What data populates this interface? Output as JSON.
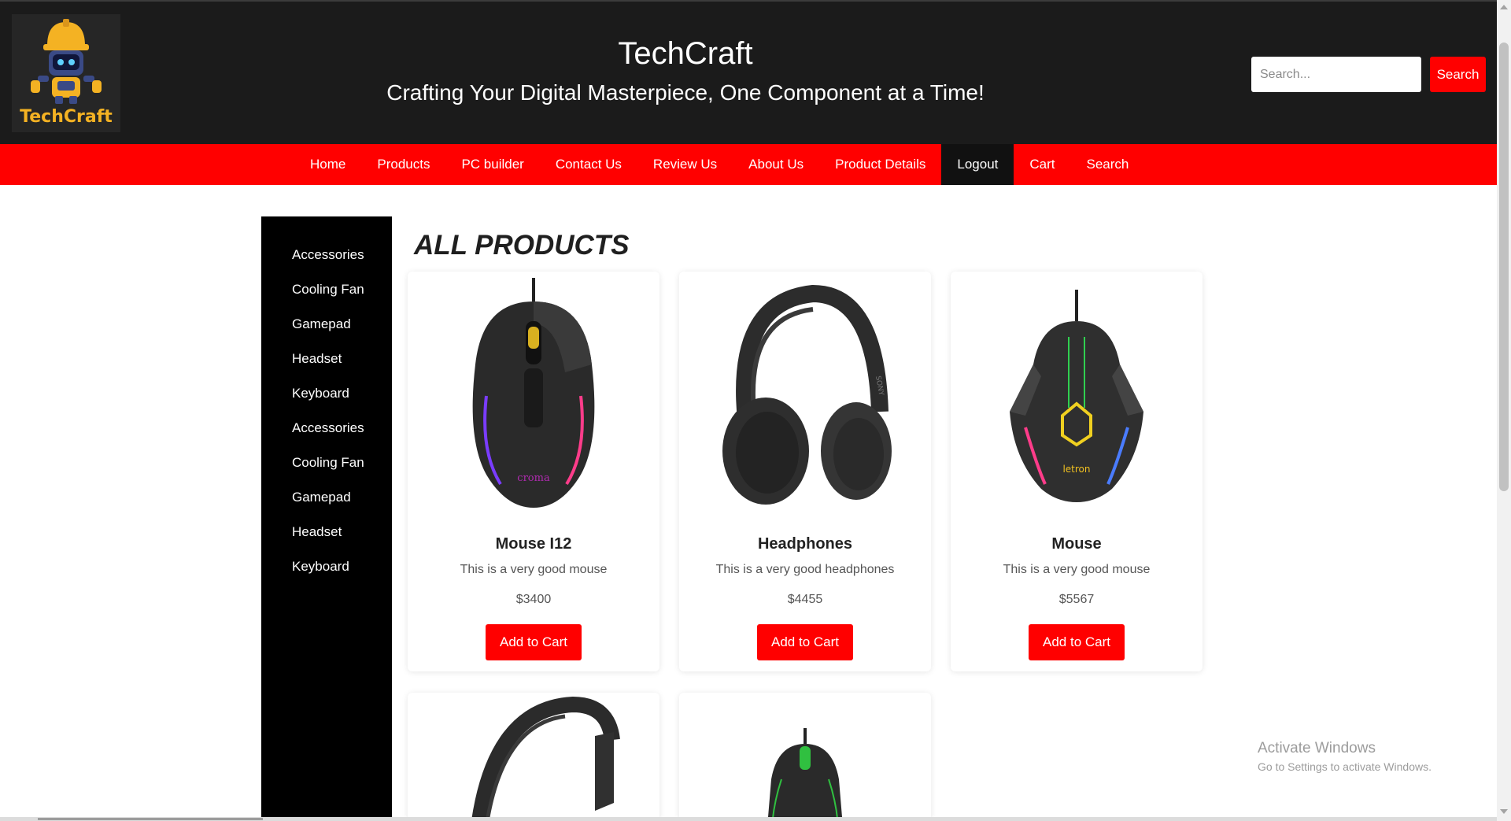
{
  "header": {
    "logo_text": "TechCraft",
    "title": "TechCraft",
    "tagline": "Crafting Your Digital Masterpiece, One Component at a Time!",
    "search_placeholder": "Search...",
    "search_button": "Search"
  },
  "nav": {
    "items": [
      "Home",
      "Products",
      "PC builder",
      "Contact Us",
      "Review Us",
      "About Us",
      "Product Details",
      "Logout",
      "Cart",
      "Search"
    ],
    "active": "Logout"
  },
  "sidebar": {
    "items": [
      "Accessories",
      "Cooling Fan",
      "Gamepad",
      "Headset",
      "Keyboard",
      "Accessories",
      "Cooling Fan",
      "Gamepad",
      "Headset",
      "Keyboard"
    ]
  },
  "main": {
    "heading": "ALL PRODUCTS",
    "products": [
      {
        "name": "Mouse I12",
        "description": "This is a very good mouse",
        "price": "$3400",
        "button": "Add to Cart",
        "image": "mouse-icon",
        "brand_mark": "croma"
      },
      {
        "name": "Headphones",
        "description": "This is a very good headphones",
        "price": "$4455",
        "button": "Add to Cart",
        "image": "headphones-icon",
        "brand_mark": "SONY"
      },
      {
        "name": "Mouse",
        "description": "This is a very good mouse",
        "price": "$5567",
        "button": "Add to Cart",
        "image": "mouse-icon",
        "brand_mark": "letron"
      }
    ]
  },
  "watermark": {
    "title": "Activate Windows",
    "subtitle": "Go to Settings to activate Windows."
  },
  "colors": {
    "accent": "#ff0000",
    "header_bg": "#1b1b1b",
    "sidebar_bg": "#000000",
    "logo_gold": "#f4b223"
  }
}
